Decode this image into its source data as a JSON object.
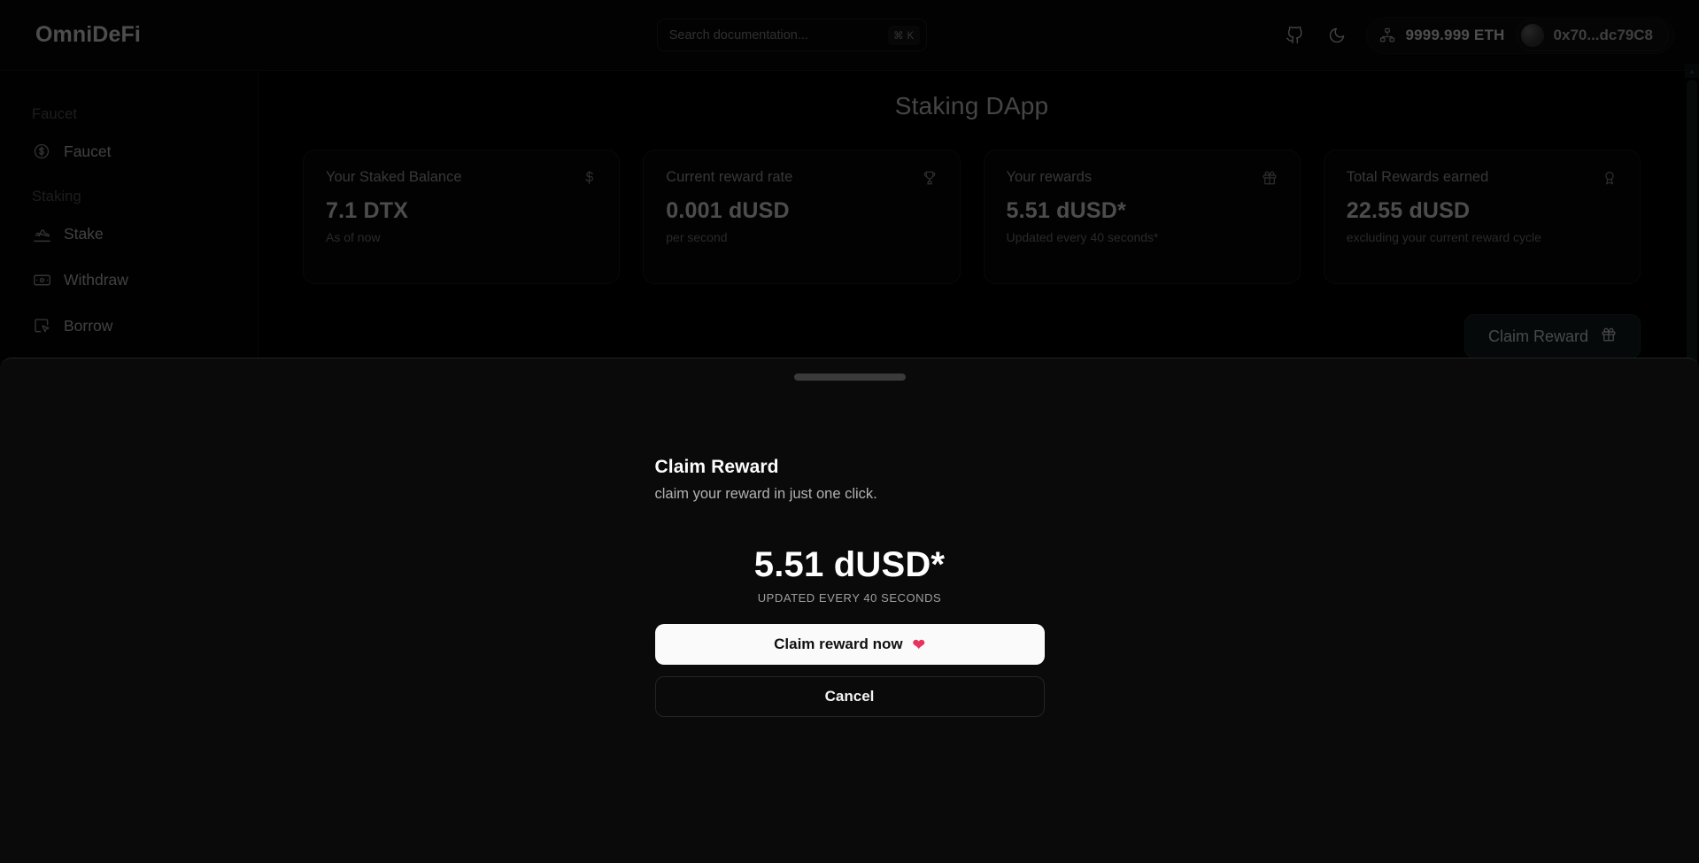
{
  "app": {
    "brand": "OmniDeFi",
    "page_title": "Staking DApp"
  },
  "topbar": {
    "search": {
      "placeholder": "Search documentation...",
      "shortcut": "⌘ K"
    },
    "github_icon": "github-icon",
    "theme_icon": "moon-icon",
    "network_icon": "network-icon",
    "eth_balance": "9999.999 ETH",
    "wallet_address": "0x70...dc79C8"
  },
  "sidebar": {
    "sections": [
      {
        "label": "Faucet",
        "items": [
          {
            "label": "Faucet",
            "icon": "circle-dollar-icon"
          }
        ]
      },
      {
        "label": "Staking",
        "items": [
          {
            "label": "Stake",
            "icon": "plane-landing-icon"
          },
          {
            "label": "Withdraw",
            "icon": "banknote-icon"
          },
          {
            "label": "Borrow",
            "icon": "cursor-box-icon"
          }
        ]
      }
    ]
  },
  "stats": [
    {
      "label": "Your Staked Balance",
      "value": "7.1 DTX",
      "sub": "As of now",
      "icon": "dollar-sign-icon"
    },
    {
      "label": "Current reward rate",
      "value": "0.001 dUSD",
      "sub": "per second",
      "icon": "trophy-icon"
    },
    {
      "label": "Your rewards",
      "value": "5.51 dUSD*",
      "sub": "Updated every 40 seconds*",
      "icon": "gift-icon"
    },
    {
      "label": "Total Rewards earned",
      "value": "22.55 dUSD",
      "sub": "excluding your current reward cycle",
      "icon": "award-icon"
    }
  ],
  "claim_button": {
    "label": "Claim Reward",
    "icon": "gift-icon"
  },
  "drawer": {
    "title": "Claim Reward",
    "description": "claim your reward in just one click.",
    "amount": "5.51 dUSD*",
    "amount_note": "UPDATED EVERY 40 SECONDS",
    "primary_label": "Claim reward now",
    "primary_icon": "heart-icon",
    "cancel_label": "Cancel"
  },
  "colors": {
    "background": "#000000",
    "surface": "#070707",
    "drawer": "#0a0a0a",
    "border": "#1a1a1a",
    "text": "#e6e6e6",
    "muted": "#7d7d7d",
    "accent_heart": "#e8345c",
    "claim_button_bg": "#101a1a"
  }
}
